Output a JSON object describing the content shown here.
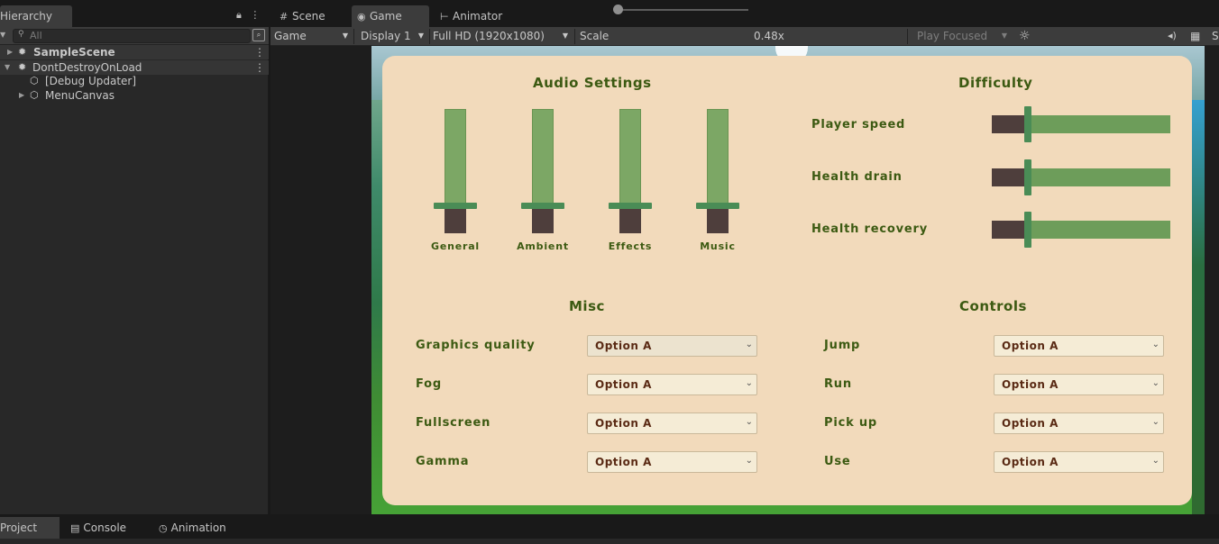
{
  "top_tabs": {
    "hierarchy": "Hierarchy",
    "scene": "Scene",
    "game": "Game",
    "animator": "Animator"
  },
  "hierarchy": {
    "search_placeholder": "All",
    "items": [
      {
        "label": "SampleScene"
      },
      {
        "label": "DontDestroyOnLoad"
      },
      {
        "label": "[Debug Updater]"
      },
      {
        "label": "MenuCanvas"
      }
    ]
  },
  "game_toolbar": {
    "view_mode": "Game",
    "display": "Display 1",
    "resolution": "Full HD (1920x1080)",
    "scale_label": "Scale",
    "scale_value": "0.48x",
    "scale_level": 0.0,
    "play_mode": "Play Focused"
  },
  "settings": {
    "audio": {
      "title": "Audio Settings",
      "sliders": [
        {
          "label": "General",
          "level": 0.78
        },
        {
          "label": "Ambient",
          "level": 0.78
        },
        {
          "label": "Effects",
          "level": 0.78
        },
        {
          "label": "Music",
          "level": 0.78
        }
      ]
    },
    "difficulty": {
      "title": "Difficulty",
      "sliders": [
        {
          "label": "Player speed",
          "level": 0.2
        },
        {
          "label": "Health drain",
          "level": 0.2
        },
        {
          "label": "Health recovery",
          "level": 0.2
        }
      ]
    },
    "misc": {
      "title": "Misc",
      "rows": [
        {
          "label": "Graphics quality",
          "value": "Option A"
        },
        {
          "label": "Fog",
          "value": "Option A"
        },
        {
          "label": "Fullscreen",
          "value": "Option A"
        },
        {
          "label": "Gamma",
          "value": "Option A"
        }
      ]
    },
    "controls": {
      "title": "Controls",
      "rows": [
        {
          "label": "Jump",
          "value": "Option A"
        },
        {
          "label": "Run",
          "value": "Option A"
        },
        {
          "label": "Pick up",
          "value": "Option A"
        },
        {
          "label": "Use",
          "value": "Option A"
        }
      ]
    }
  },
  "bottom_tabs": {
    "project": "Project",
    "console": "Console",
    "animation": "Animation"
  },
  "colors": {
    "panel_bg": "#f2dabb",
    "title_green": "#3c5a12",
    "slider_fill": "#7ca765",
    "slider_bg": "#4e3e3c",
    "dropdown_text": "#5a2a14"
  }
}
